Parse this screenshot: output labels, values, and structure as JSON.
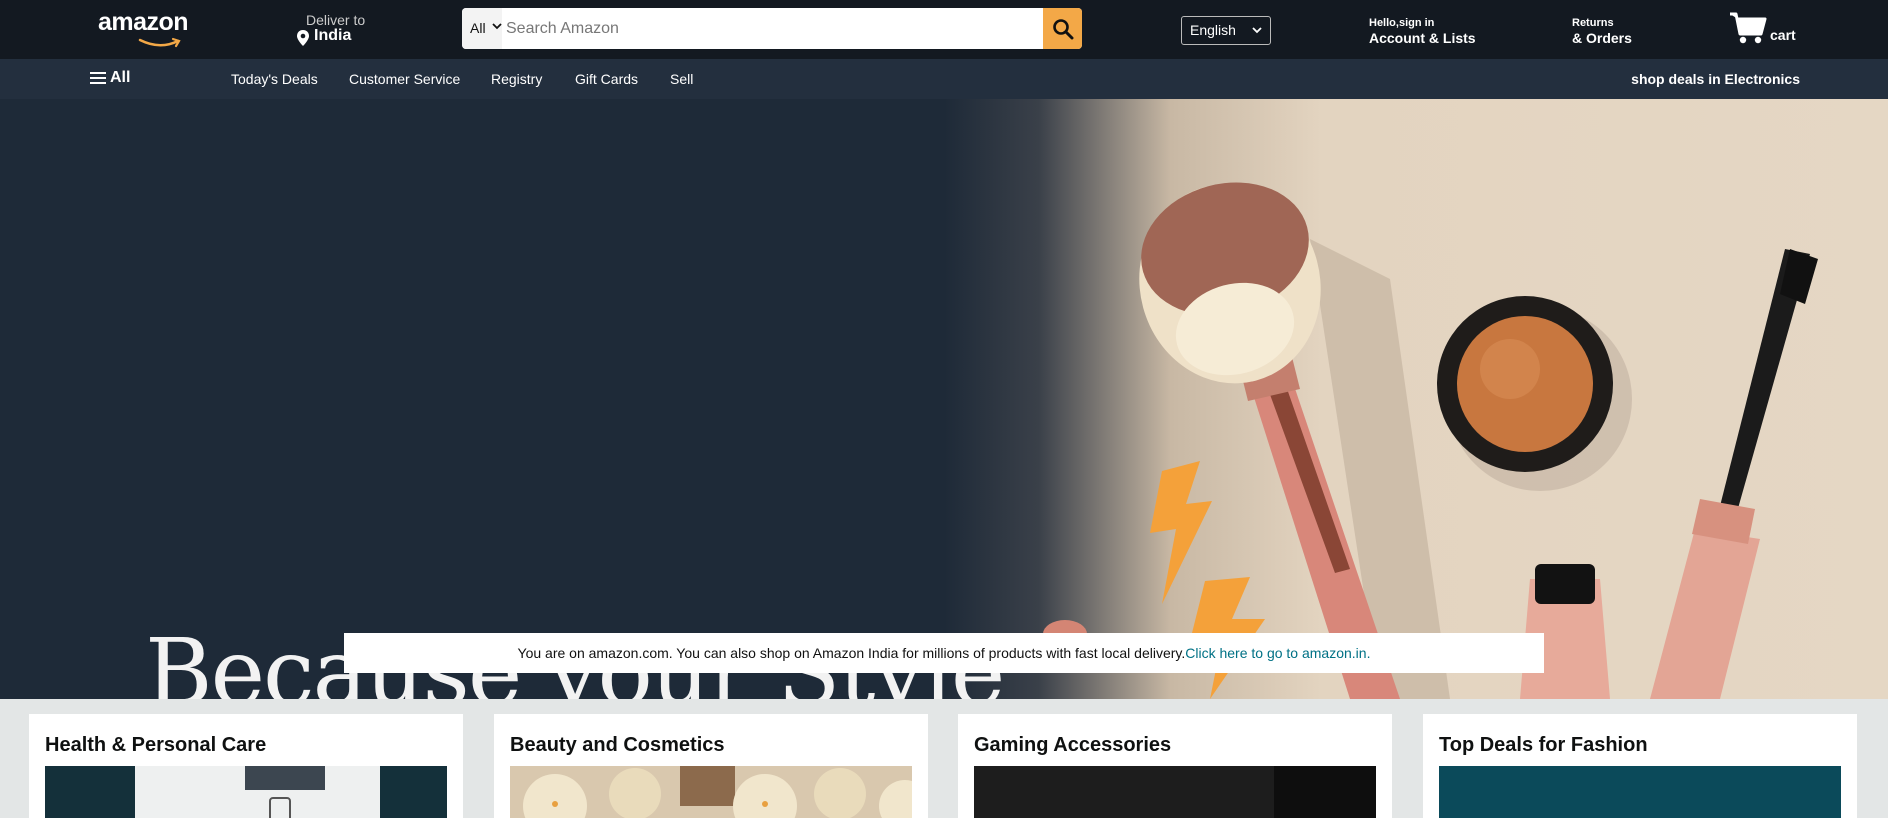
{
  "header": {
    "logo_text": "amazon",
    "deliver_label": "Deliver to",
    "deliver_location": "India",
    "search": {
      "category": "All",
      "placeholder": "Search Amazon"
    },
    "language": "English",
    "account_line1": "Hello,sign in",
    "account_line2": "Account & Lists",
    "returns_line1": "Returns",
    "returns_line2": "& Orders",
    "cart_label": "cart"
  },
  "subnav": {
    "all_label": "All",
    "links": [
      "Today's Deals",
      "Customer Service",
      "Registry",
      "Gift Cards",
      "Sell"
    ],
    "promo": "shop deals in Electronics"
  },
  "hero": {
    "headline": "Because your Style"
  },
  "notice": {
    "text": "You are on amazon.com. You can also shop on Amazon India for millions of products with fast local delivery.",
    "link_text": "Click here to go to amazon.in."
  },
  "cards": [
    {
      "title": "Health & Personal Care"
    },
    {
      "title": "Beauty and Cosmetics"
    },
    {
      "title": "Gaming Accessories"
    },
    {
      "title": "Top Deals for Fashion"
    }
  ],
  "colors": {
    "nav_bg": "#131921",
    "subnav_bg": "#232f3e",
    "search_button": "#f3a847",
    "link": "#007185"
  }
}
